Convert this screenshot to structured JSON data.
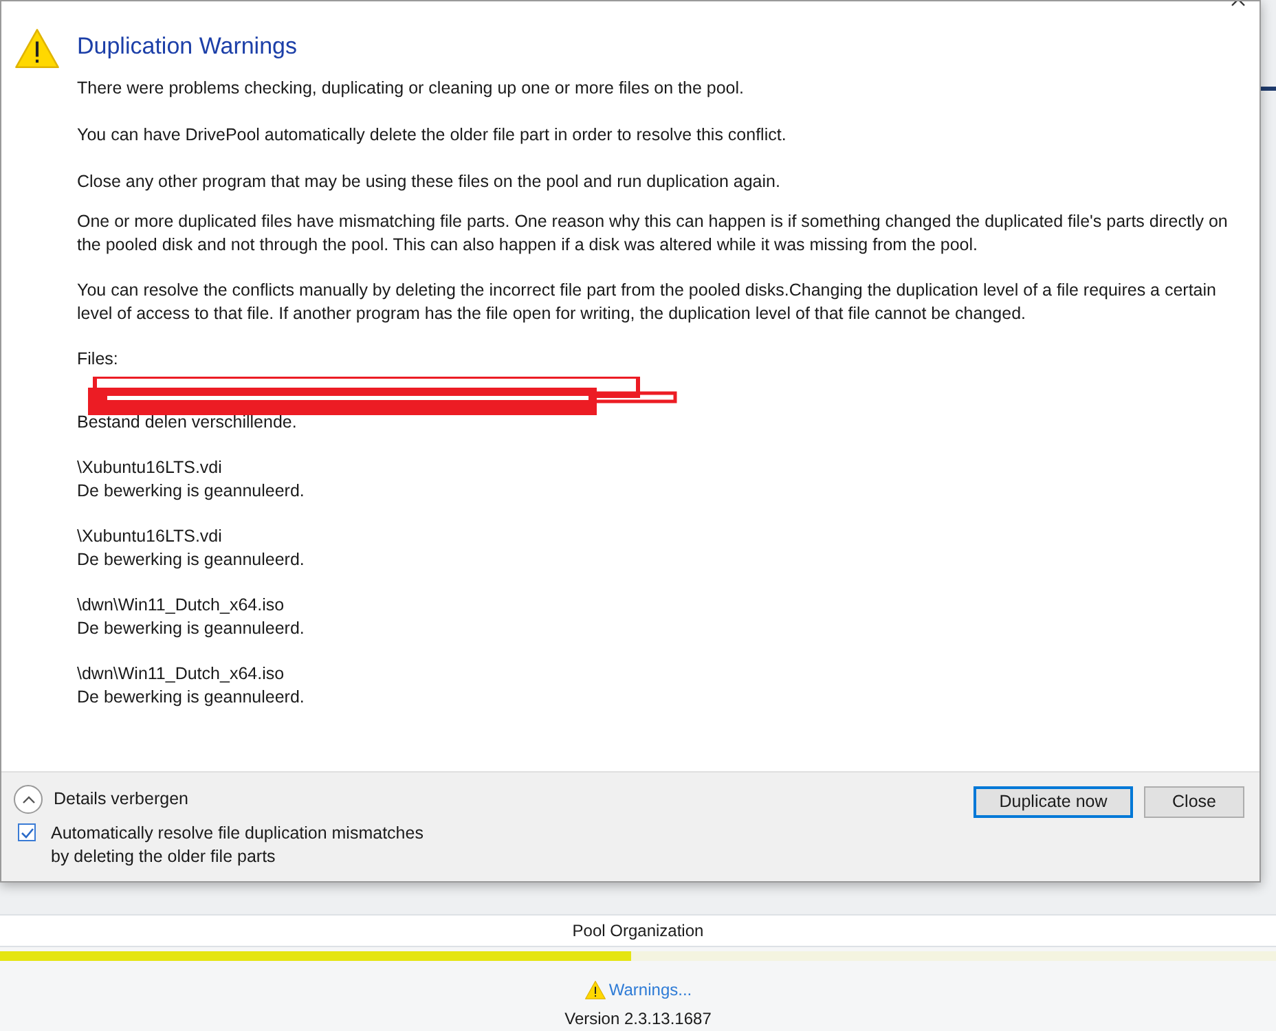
{
  "dialog": {
    "heading": "Duplication Warnings",
    "paragraphs": [
      "There were problems checking, duplicating or cleaning up one or more files on the pool.",
      "You can have DrivePool automatically delete the older file part in order to resolve this conflict.",
      "Close any other program that may be using these files on the pool and run duplication again."
    ],
    "details": [
      "One or more duplicated files have mismatching file parts. One reason why this can happen is if something changed the duplicated file's parts directly on the pooled disk and not through the pool. This can also happen if a disk was altered while it was missing from the pool.",
      "You can resolve the conflicts manually by deleting the incorrect file part from the pooled disks.Changing the duplication level of a file requires a certain level of access to that file. If another program has the file open for writing, the duplication level of that file cannot be changed."
    ],
    "files_label": "Files:",
    "files": [
      {
        "kind": "redacted",
        "message": "Bestand delen verschillende."
      },
      {
        "kind": "path",
        "path": "\\Xubuntu16LTS.vdi",
        "message": "De bewerking is geannuleerd."
      },
      {
        "kind": "path",
        "path": "\\Xubuntu16LTS.vdi",
        "message": "De bewerking is geannuleerd."
      },
      {
        "kind": "path",
        "path": "\\dwn\\Win11_Dutch_x64.iso",
        "message": "De bewerking is geannuleerd."
      },
      {
        "kind": "path",
        "path": "\\dwn\\Win11_Dutch_x64.iso",
        "message": "De bewerking is geannuleerd."
      }
    ],
    "details_toggle": {
      "label": "Details verbergen",
      "expanded": true
    },
    "auto_resolve": {
      "label": "Automatically resolve file duplication mismatches\nby deleting the older file parts",
      "checked": true
    },
    "buttons": [
      {
        "label": "Duplicate now",
        "selected": true
      },
      {
        "label": "Close",
        "selected": false
      }
    ]
  },
  "background": {
    "section_title": "Pool Organization",
    "progress": {
      "level": 0.495
    },
    "warnings_link": "Warnings...",
    "version": "Version 2.3.13.1687"
  }
}
